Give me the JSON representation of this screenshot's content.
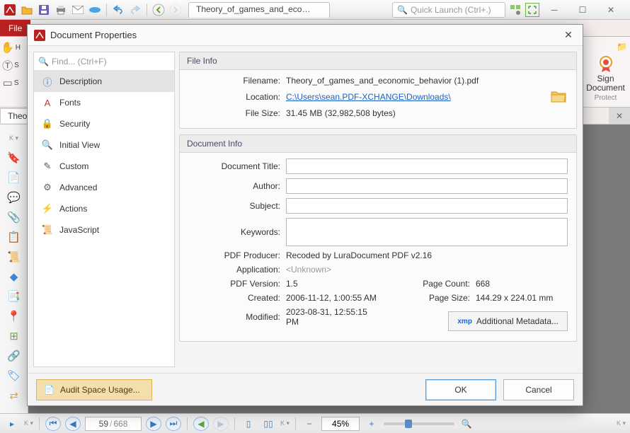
{
  "window": {
    "tab_title": "Theory_of_games_and_econo..",
    "quick_launch_placeholder": "Quick Launch (Ctrl+.)",
    "lower_tab": "Theor"
  },
  "ribbon": {
    "file": "File",
    "sign_line1": "Sign",
    "sign_line2": "Document",
    "sign_group": "Protect",
    "partial_h": "H",
    "partial_s1": "S",
    "partial_s2": "S"
  },
  "status": {
    "page_current": "59",
    "page_total": "668",
    "zoom": "45%"
  },
  "modal": {
    "title": "Document Properties",
    "find_placeholder": "Find... (Ctrl+F)",
    "categories": [
      {
        "k": "description",
        "label": "Description"
      },
      {
        "k": "fonts",
        "label": "Fonts"
      },
      {
        "k": "security",
        "label": "Security"
      },
      {
        "k": "initial",
        "label": "Initial View"
      },
      {
        "k": "custom",
        "label": "Custom"
      },
      {
        "k": "advanced",
        "label": "Advanced"
      },
      {
        "k": "actions",
        "label": "Actions"
      },
      {
        "k": "javascript",
        "label": "JavaScript"
      }
    ],
    "file_info": {
      "header": "File Info",
      "filename_lab": "Filename:",
      "filename": "Theory_of_games_and_economic_behavior (1).pdf",
      "location_lab": "Location:",
      "location": "C:\\Users\\sean.PDF-XCHANGE\\Downloads\\",
      "filesize_lab": "File Size:",
      "filesize": "31.45 MB (32,982,508 bytes)"
    },
    "doc_info": {
      "header": "Document Info",
      "title_lab": "Document Title:",
      "author_lab": "Author:",
      "subject_lab": "Subject:",
      "keywords_lab": "Keywords:",
      "producer_lab": "PDF Producer:",
      "producer": "Recoded by LuraDocument PDF v2.16",
      "application_lab": "Application:",
      "application": "<Unknown>",
      "version_lab": "PDF Version:",
      "version": "1.5",
      "pagecount_lab": "Page Count:",
      "pagecount": "668",
      "created_lab": "Created:",
      "created": "2006-11-12, 1:00:55 AM",
      "pagesize_lab": "Page Size:",
      "pagesize": "144.29 x 224.01 mm",
      "modified_lab": "Modified:",
      "modified": "2023-08-31, 12:55:15 PM",
      "metadata_btn": "Additional Metadata...",
      "xmp": "xmp"
    },
    "audit": "Audit Space Usage...",
    "ok": "OK",
    "cancel": "Cancel"
  }
}
